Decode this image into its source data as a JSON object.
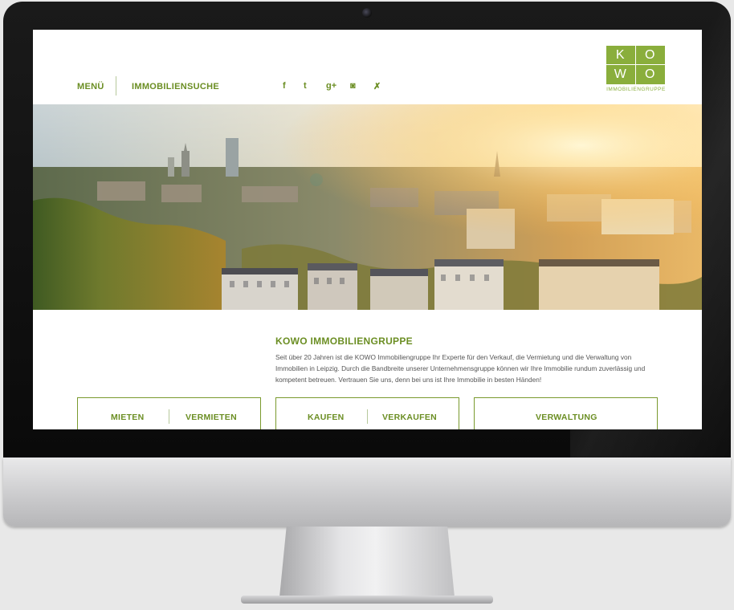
{
  "header": {
    "menu_label": "MENÜ",
    "search_label": "IMMOBILIENSUCHE",
    "social": [
      "facebook-icon",
      "twitter-icon",
      "google-plus-icon",
      "instagram-icon",
      "xing-icon"
    ],
    "social_glyphs": [
      "f",
      "t",
      "g+",
      "◙",
      "✗"
    ]
  },
  "logo": {
    "letters": [
      "K",
      "O",
      "W",
      "O"
    ],
    "subtitle": "IMMOBILIENGRUPPE",
    "color": "#8aae3c"
  },
  "intro": {
    "title": "KOWO IMMOBILIENGRUPPE",
    "text": "Seit über 20 Jahren ist die KOWO Immobiliengruppe Ihr Experte für den Verkauf, die Vermietung und die Verwaltung von Immobilien in Leipzig. Durch die Bandbreite unserer Unternehmensgruppe können wir Ihre Immobilie rundum zuverlässig und kompetent betreuen. Vertrauen Sie uns, denn bei uns ist Ihre Immobilie in besten Händen!"
  },
  "boxes": [
    {
      "left": "MIETEN",
      "right": "VERMIETEN"
    },
    {
      "left": "KAUFEN",
      "right": "VERKAUFEN"
    },
    {
      "single": "VERWALTUNG"
    }
  ],
  "colors": {
    "accent": "#6b8e23",
    "bezel": "#111111"
  }
}
